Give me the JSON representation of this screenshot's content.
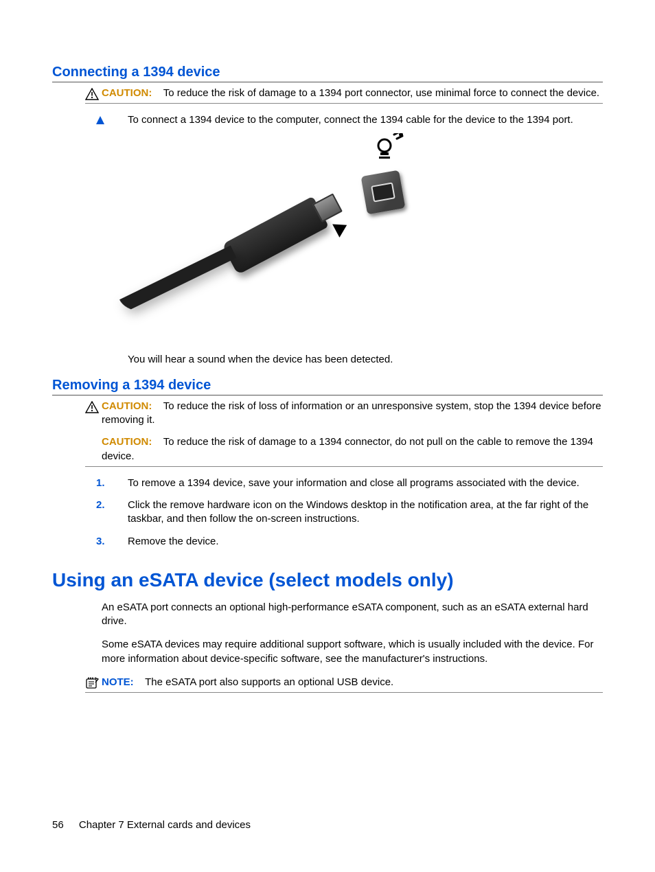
{
  "sections": {
    "connect_heading": "Connecting a 1394 device",
    "connect_caution_label": "CAUTION:",
    "connect_caution_text": "To reduce the risk of damage to a 1394 port connector, use minimal force to connect the device.",
    "connect_step_text": "To connect a 1394 device to the computer, connect the 1394 cable for the device to the 1394 port.",
    "connect_after_text": "You will hear a sound when the device has been detected.",
    "remove_heading": "Removing a 1394 device",
    "remove_caution1_label": "CAUTION:",
    "remove_caution1_text": "To reduce the risk of loss of information or an unresponsive system, stop the 1394 device before removing it.",
    "remove_caution2_label": "CAUTION:",
    "remove_caution2_text": "To reduce the risk of damage to a 1394 connector, do not pull on the cable to remove the 1394 device.",
    "remove_steps": [
      "To remove a 1394 device, save your information and close all programs associated with the device.",
      "Click the remove hardware icon on the Windows desktop in the notification area, at the far right of the taskbar, and then follow the on-screen instructions.",
      "Remove the device."
    ],
    "esata_heading": "Using an eSATA device (select models only)",
    "esata_p1": "An eSATA port connects an optional high-performance eSATA component, such as an eSATA external hard drive.",
    "esata_p2": "Some eSATA devices may require additional support software, which is usually included with the device. For more information about device-specific software, see the manufacturer's instructions.",
    "esata_note_label": "NOTE:",
    "esata_note_text": "The eSATA port also supports an optional USB device."
  },
  "footer": {
    "page_number": "56",
    "chapter": "Chapter 7   External cards and devices"
  }
}
